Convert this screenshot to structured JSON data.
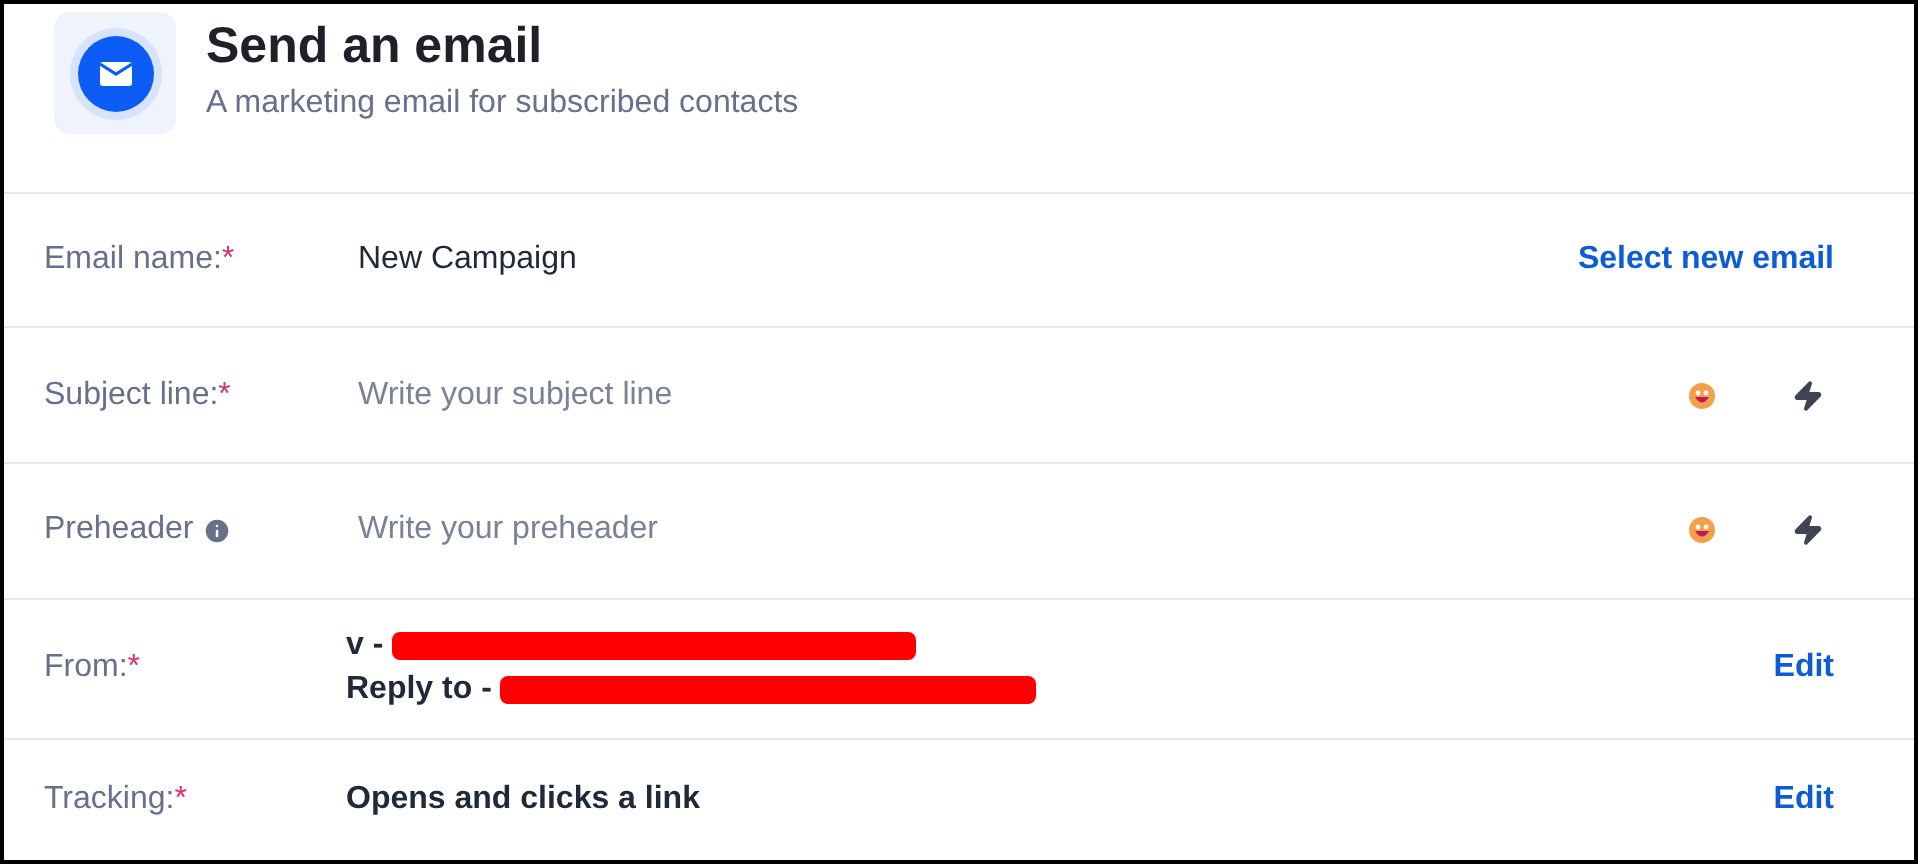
{
  "header": {
    "title": "Send an email",
    "subtitle": "A marketing email for subscribed contacts"
  },
  "rows": [
    {
      "kind": "value",
      "label": "Email name:",
      "required_mark": "*",
      "value": "New Campaign",
      "action": "Select new email"
    },
    {
      "kind": "input",
      "label": "Subject line:",
      "required_mark": "*",
      "placeholder": "Write your subject line"
    },
    {
      "kind": "input",
      "label": "Preheader",
      "info": true,
      "placeholder": "Write your preheader"
    },
    {
      "kind": "lines",
      "label": "From:",
      "required_mark": "*",
      "lines": [
        {
          "text": "v -",
          "redacted": true
        },
        {
          "text": "Reply to -",
          "redacted": true
        }
      ],
      "action": "Edit"
    },
    {
      "kind": "lines",
      "label": "Tracking:",
      "required_mark": "*",
      "lines": [
        {
          "text": "Opens and clicks a link"
        }
      ],
      "action": "Edit"
    }
  ]
}
